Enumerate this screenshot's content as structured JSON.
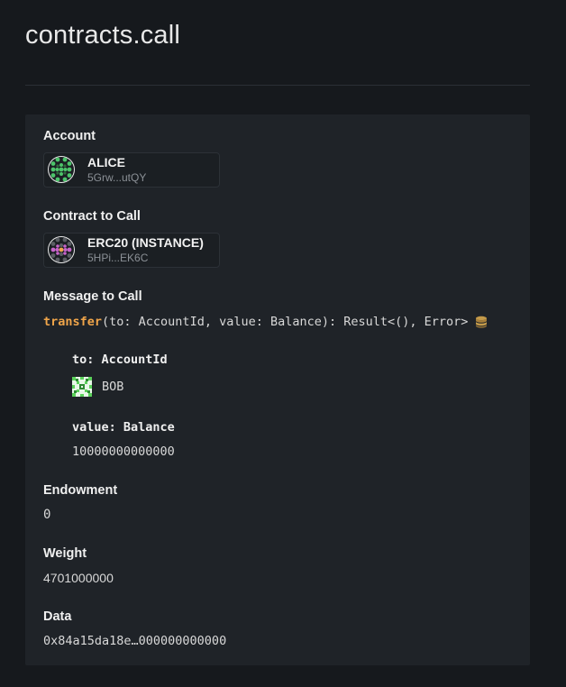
{
  "page": {
    "title": "contracts.call"
  },
  "account": {
    "label": "Account",
    "name": "ALICE",
    "address": "5Grw...utQY"
  },
  "contract": {
    "label": "Contract to Call",
    "name": "ERC20 (INSTANCE)",
    "address": "5HPi...EK6C"
  },
  "message": {
    "label": "Message to Call",
    "fn_name": "transfer",
    "signature": "(to: AccountId, value: Balance): Result<(), Error>",
    "icon": "database-icon",
    "args": [
      {
        "label": "to: AccountId",
        "value": "BOB",
        "icon": "identicon"
      },
      {
        "label": "value: Balance",
        "value": "10000000000000"
      }
    ]
  },
  "endowment": {
    "label": "Endowment",
    "value": "0"
  },
  "weight": {
    "label": "Weight",
    "value": "4701000000"
  },
  "data": {
    "label": "Data",
    "value": "0x84a15da18e…000000000000"
  },
  "colors": {
    "background": "#16191d",
    "panel": "#1f2328",
    "accent": "#f0a54a",
    "alice_identicon": "#4cc36a",
    "contract_identicon": "#c765c9",
    "bob_identicon": "#5bd15b"
  }
}
